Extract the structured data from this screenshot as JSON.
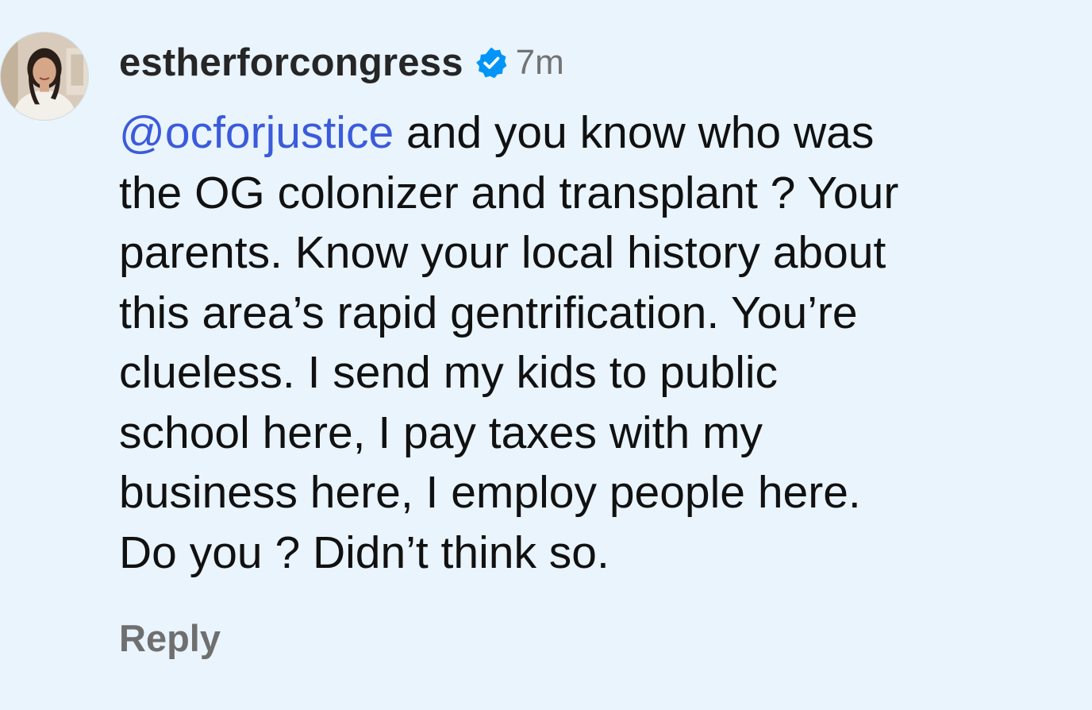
{
  "comment": {
    "username": "estherforcongress",
    "verified_icon": "verified-badge-icon",
    "verified_color": "#0095f6",
    "timestamp": "7m",
    "mention": "@ocforjustice",
    "lines": [
      " and you know who was",
      "the OG colonizer and transplant ? Your",
      "parents. Know your local history about",
      "this area’s rapid gentrification. You’re",
      "clueless. I send my kids to public",
      "school here, I pay taxes with my",
      "business here, I employ people here.",
      "Do you ? Didn’t think so."
    ],
    "reply_label": "Reply"
  },
  "colors": {
    "background": "#e9f4fd",
    "mention": "#3b5bdb",
    "text": "#111111",
    "muted": "#737373"
  }
}
